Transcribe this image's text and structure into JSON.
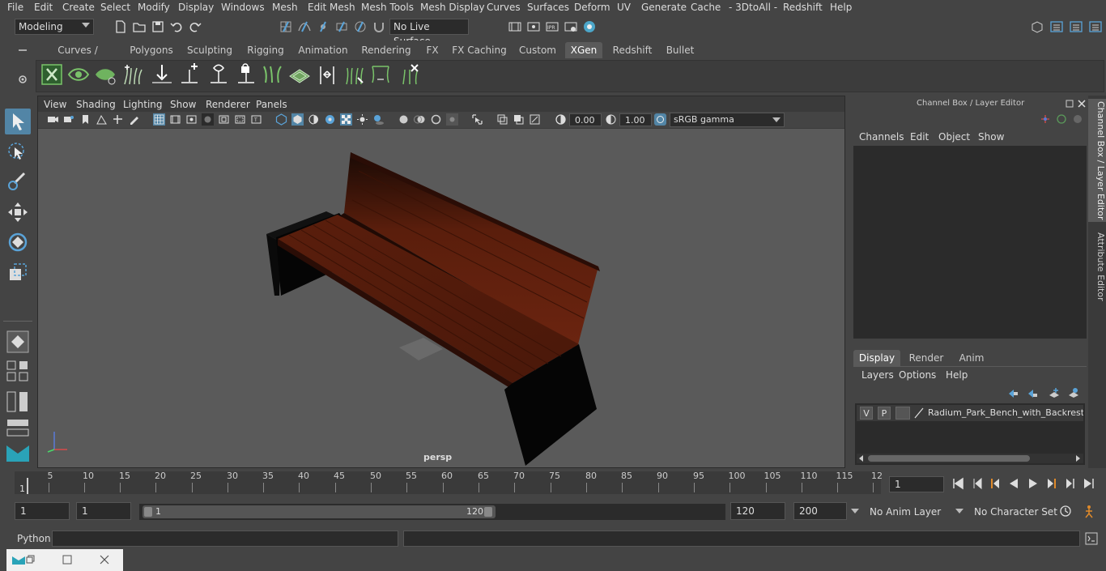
{
  "menubar": {
    "items": [
      "File",
      "Edit",
      "Create",
      "Select",
      "Modify",
      "Display",
      "Windows",
      "Mesh",
      "Edit Mesh",
      "Mesh Tools",
      "Mesh Display",
      "Curves",
      "Surfaces",
      "Deform",
      "UV",
      "Generate",
      "Cache",
      "- 3DtoAll -",
      "Redshift",
      "Help"
    ]
  },
  "statusline": {
    "mode": "Modeling",
    "live_surface": "No Live Surface"
  },
  "shelf": {
    "tabs": [
      "Curves / Surfaces",
      "Polygons",
      "Sculpting",
      "Rigging",
      "Animation",
      "Rendering",
      "FX",
      "FX Caching",
      "Custom",
      "XGen",
      "Redshift",
      "Bullet"
    ],
    "active_tab": "XGen"
  },
  "viewport": {
    "menus": [
      "View",
      "Shading",
      "Lighting",
      "Show",
      "Renderer",
      "Panels"
    ],
    "exposure": "0.00",
    "gamma": "1.00",
    "color_space": "sRGB gamma",
    "camera_label": "persp"
  },
  "right_panel": {
    "title": "Channel Box / Layer Editor",
    "menus": [
      "Channels",
      "Edit",
      "Object",
      "Show"
    ],
    "tabs": [
      "Display",
      "Render",
      "Anim"
    ],
    "active_tab": "Display",
    "layer_menus": [
      "Layers",
      "Options",
      "Help"
    ],
    "layer": {
      "v": "V",
      "p": "P",
      "name": "Radium_Park_Bench_with_Backrest_St"
    },
    "side_tabs": [
      "Channel Box / Layer Editor",
      "Attribute Editor"
    ]
  },
  "timeline": {
    "ticks": [
      "5",
      "10",
      "15",
      "20",
      "25",
      "30",
      "35",
      "40",
      "45",
      "50",
      "55",
      "60",
      "65",
      "70",
      "75",
      "80",
      "85",
      "90",
      "95",
      "100",
      "105",
      "110",
      "115",
      "12"
    ],
    "start_label": "1",
    "current_frame": "1"
  },
  "range": {
    "start": "1",
    "playback_start": "1",
    "slider_start": "1",
    "slider_end": "120",
    "playback_end": "120",
    "end": "200",
    "anim_layer": "No Anim Layer",
    "character_set": "No Character Set"
  },
  "cmdline": {
    "label": "Python"
  },
  "colors": {
    "accent": "#5285a6",
    "bench_wood": "#5a1e0c",
    "viewport_bg": "#5a5a5a"
  }
}
